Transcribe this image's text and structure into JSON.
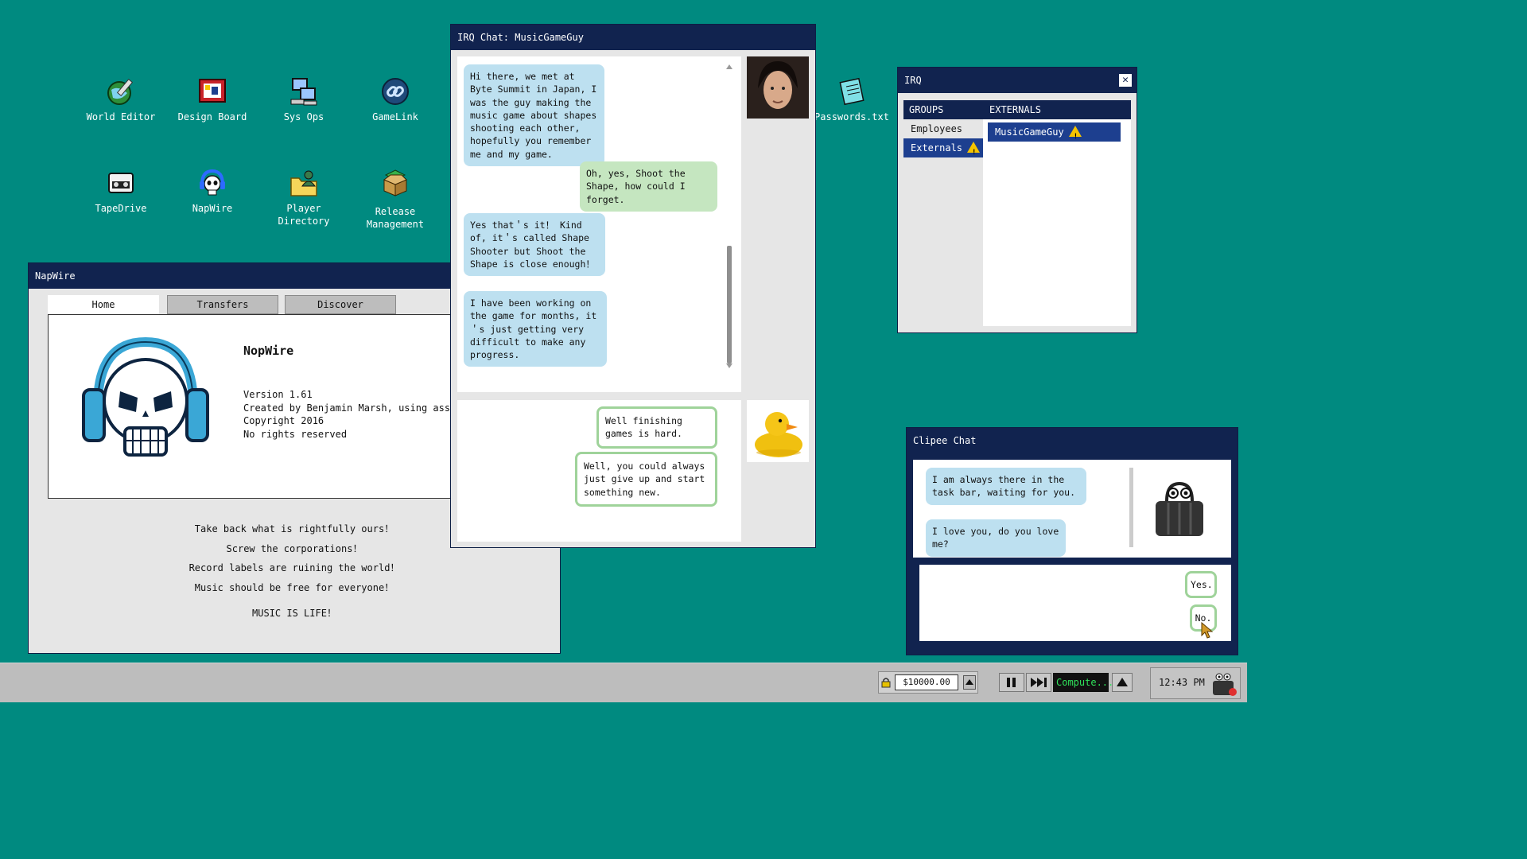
{
  "desktop": {
    "icons": [
      {
        "label": "World Editor",
        "icon": "globe-pencil-icon"
      },
      {
        "label": "Design Board",
        "icon": "board-icon"
      },
      {
        "label": "Sys Ops",
        "icon": "computers-icon"
      },
      {
        "label": "GameLink",
        "icon": "chain-link-icon"
      },
      {
        "label": "TapeDrive",
        "icon": "cassette-icon"
      },
      {
        "label": "NapWire",
        "icon": "skull-headphones-icon"
      },
      {
        "label": "Player Directory",
        "icon": "folder-user-icon"
      },
      {
        "label": "Release Management",
        "icon": "box-icon"
      },
      {
        "label": "Passwords.txt",
        "icon": "notepad-icon"
      }
    ]
  },
  "napwire": {
    "title": "NapWire",
    "tabs": [
      "Home",
      "Transfers",
      "Discover"
    ],
    "app_name": "NopWire",
    "version": "Version 1.61",
    "created": "Created by Benjamin Marsh, using assembly.",
    "copyright": "Copyright 2016",
    "rights": "No rights reserved",
    "slogans": [
      "Take back what is rightfully ours！",
      "Screw the corporations！",
      "Record labels are ruining the world！",
      "Music should be free for everyone！",
      "MUSIC IS LIFE！"
    ]
  },
  "irq_chat": {
    "title": "IRQ Chat: MusicGameGuy",
    "messages": [
      {
        "from": "them",
        "text": "Hi there, we met at Byte Summit in Japan, I was the guy making the music game about shapes shooting each other, hopefully you remember me and my game."
      },
      {
        "from": "me",
        "text": "Oh, yes, Shoot the Shape, how could I forget."
      },
      {
        "from": "them",
        "text": "Yes that＇s it！ Kind of, it＇s called Shape Shooter but Shoot the Shape is close enough！"
      },
      {
        "from": "them",
        "text": "I have been working on the game for months, it＇s just getting very difficult to make any progress."
      }
    ],
    "replies": [
      "Well finishing games is hard.",
      "Well, you could always just give up and start something new."
    ]
  },
  "irq": {
    "title": "IRQ",
    "groups_header": "GROUPS",
    "externals_header": "EXTERNALS",
    "groups": [
      "Employees",
      "Externals"
    ],
    "contact": "MusicGameGuy"
  },
  "clipee": {
    "title": "Clipee Chat",
    "messages": [
      "I am always there in the task bar, waiting for you.",
      "I love you, do you love me?"
    ],
    "replies": [
      "Yes.",
      "No."
    ]
  },
  "taskbar": {
    "money": "$10000.00",
    "status": "Compute...",
    "clock": "12:43 PM"
  },
  "colors": {
    "desktop": "#008a80",
    "titlebar": "#11234f",
    "bubble_in": "#bde0f0",
    "bubble_out": "#c5e6c0",
    "selection": "#1d3f8f",
    "warning": "#f5c400"
  }
}
